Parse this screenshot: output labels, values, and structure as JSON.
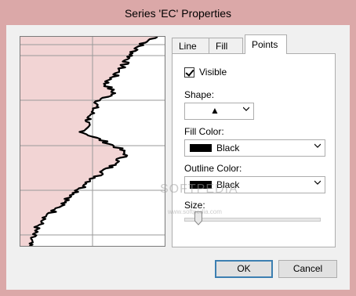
{
  "window": {
    "title": "Series 'EC' Properties"
  },
  "tabs": [
    {
      "label": "Line"
    },
    {
      "label": "Fill"
    },
    {
      "label": "Points"
    }
  ],
  "points": {
    "visible_label": "Visible",
    "visible_checked": true,
    "shape_label": "Shape:",
    "shape_value": "▲",
    "fill_color_label": "Fill Color:",
    "fill_color_value": "Black",
    "outline_color_label": "Outline Color:",
    "outline_color_value": "Black",
    "size_label": "Size:",
    "size_level": 0.05
  },
  "buttons": {
    "ok": "OK",
    "cancel": "Cancel"
  },
  "watermark": {
    "text": "SOFTPEDIA",
    "subtext": "www.softpedia.com"
  },
  "colors": {
    "title_bar": "#dba8a8",
    "fill_area": "#f2d4d4",
    "series_line": "#000000",
    "swatch": "#000000"
  }
}
